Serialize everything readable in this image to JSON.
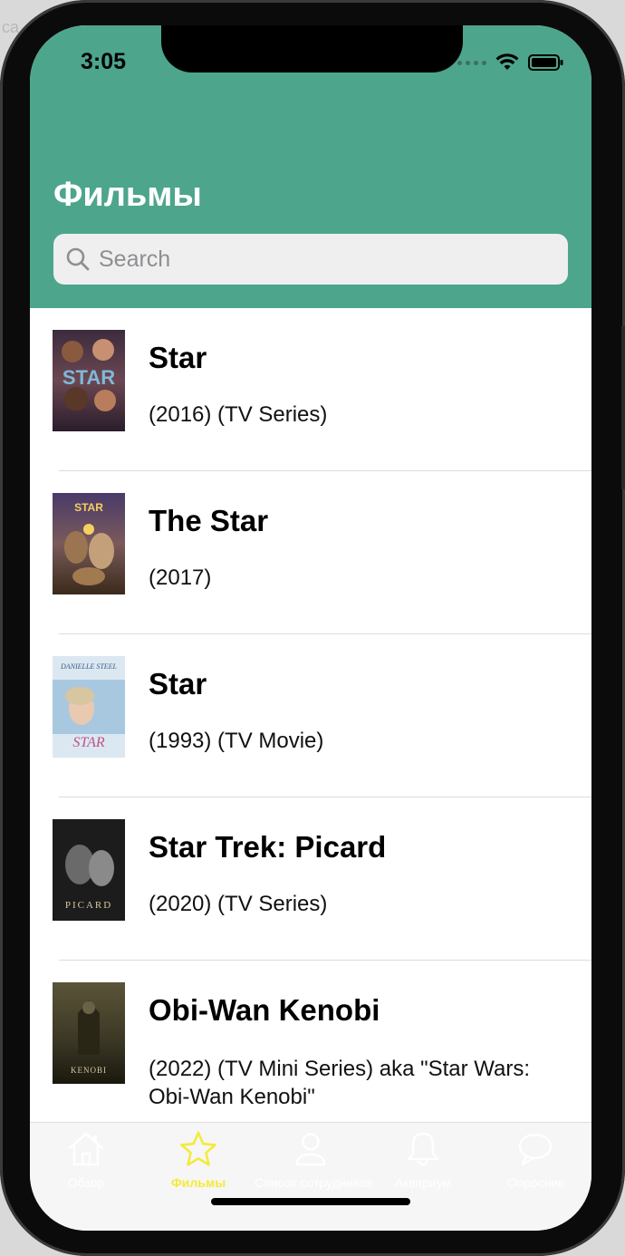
{
  "background_text": "ca",
  "status_bar": {
    "time": "3:05"
  },
  "header": {
    "title": "Фильмы",
    "bg_color": "#4da58c"
  },
  "search": {
    "placeholder": "Search",
    "value": ""
  },
  "movies": [
    {
      "title": "Star",
      "subtitle": "(2016) (TV Series)",
      "poster_icon": "star-2016-poster",
      "poster_text": "STAR"
    },
    {
      "title": "The Star",
      "subtitle": "(2017)",
      "poster_icon": "the-star-2017-poster",
      "poster_text": "STAR"
    },
    {
      "title": "Star",
      "subtitle": "(1993) (TV Movie)",
      "poster_icon": "star-1993-poster",
      "poster_text": "DANIELLE STEEL",
      "poster_text2": "STAR"
    },
    {
      "title": "Star Trek: Picard",
      "subtitle": "(2020) (TV Series)",
      "poster_icon": "picard-poster",
      "poster_text": "PICARD"
    },
    {
      "title": "Obi-Wan Kenobi",
      "subtitle": "(2022) (TV Mini Series) aka \"Star Wars: Obi-Wan Kenobi\"",
      "poster_icon": "kenobi-poster",
      "poster_text": "KENOBI"
    }
  ],
  "tabbar": {
    "active_color": "#f4ea3c",
    "tabs": [
      {
        "label": "Обзор",
        "icon": "house-icon",
        "active": false
      },
      {
        "label": "Фильмы",
        "icon": "star-icon",
        "active": true
      },
      {
        "label": "Список сотрудников",
        "icon": "person-icon",
        "active": false
      },
      {
        "label": "Аквариум",
        "icon": "bell-icon",
        "active": false
      },
      {
        "label": "Опросник",
        "icon": "speech-bubble-icon",
        "active": false
      }
    ]
  }
}
